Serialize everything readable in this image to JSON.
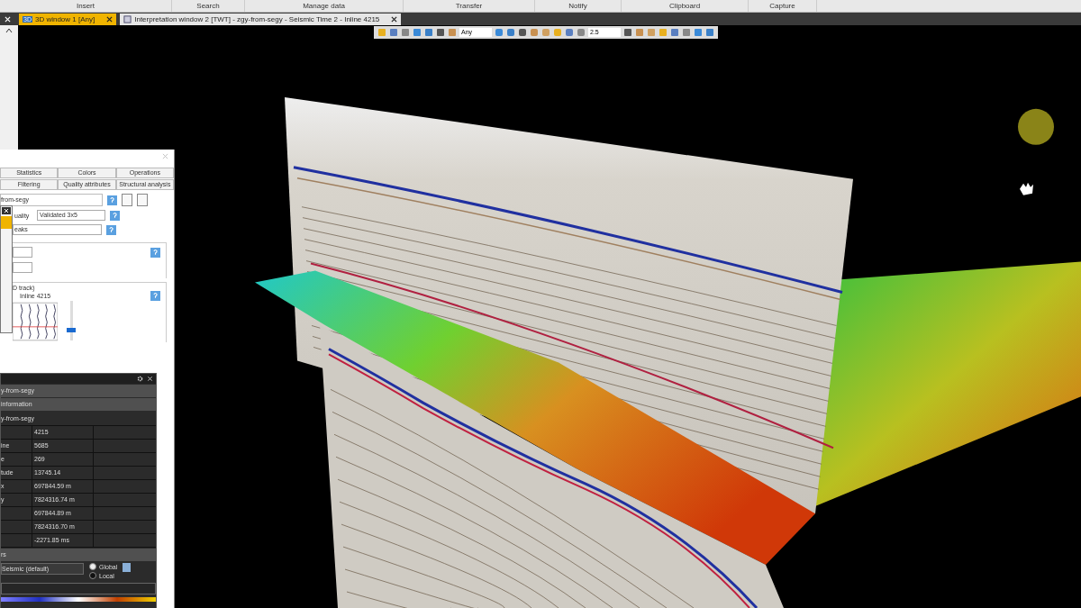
{
  "ribbon_groups": [
    "Insert",
    "Search",
    "Manage data",
    "Transfer",
    "Notify",
    "Clipboard",
    "Capture"
  ],
  "tabs": [
    {
      "label": "3D window 1 [Any]",
      "badge": "3D",
      "selected": true
    },
    {
      "label": "Interpretation window 2 [TWT] - zgy-from-segy - Seismic Time 2 - Inline 4215",
      "selected": false
    }
  ],
  "toolbar": {
    "dropdowns": [
      "Any",
      "2.5"
    ]
  },
  "settings_panel": {
    "tabs_row_1": [
      {
        "label": "Statistics",
        "selected": false
      },
      {
        "label": "Colors",
        "selected": false
      },
      {
        "label": "Operations",
        "selected": false
      }
    ],
    "tabs_row_2": [
      {
        "label": "Filtering",
        "selected": false
      },
      {
        "label": "Quality attributes",
        "selected": false
      },
      {
        "label": "Structural analysis",
        "selected": false
      }
    ],
    "name_value": "from-segy",
    "quality_label": "uality",
    "quality_value": "Validated 3x5",
    "mode_value": "eaks",
    "track_label": "D track)",
    "inline_label": "Inline 4215",
    "slider": {
      "level": 0.2
    }
  },
  "info_panel": {
    "object": "y-from-segy",
    "section": "information",
    "subtitle": "y-from-segy",
    "rows": [
      {
        "value": "4215"
      },
      {
        "label": "ine",
        "value": "5685"
      },
      {
        "label": "e",
        "value": "269"
      },
      {
        "label": "tude",
        "value": "13745.14"
      },
      {
        "label": "x",
        "value": "697844.59 m"
      },
      {
        "label": "y",
        "value": "7824316.74 m"
      },
      {
        "value": "697844.89 m"
      },
      {
        "value": "7824316.70 m"
      },
      {
        "value": "-2271.85 ms"
      }
    ],
    "colors_section": "rs",
    "colortable": "Seismic (default)",
    "scope": [
      {
        "label": "Global",
        "selected": true
      },
      {
        "label": "Local",
        "selected": false
      }
    ]
  }
}
